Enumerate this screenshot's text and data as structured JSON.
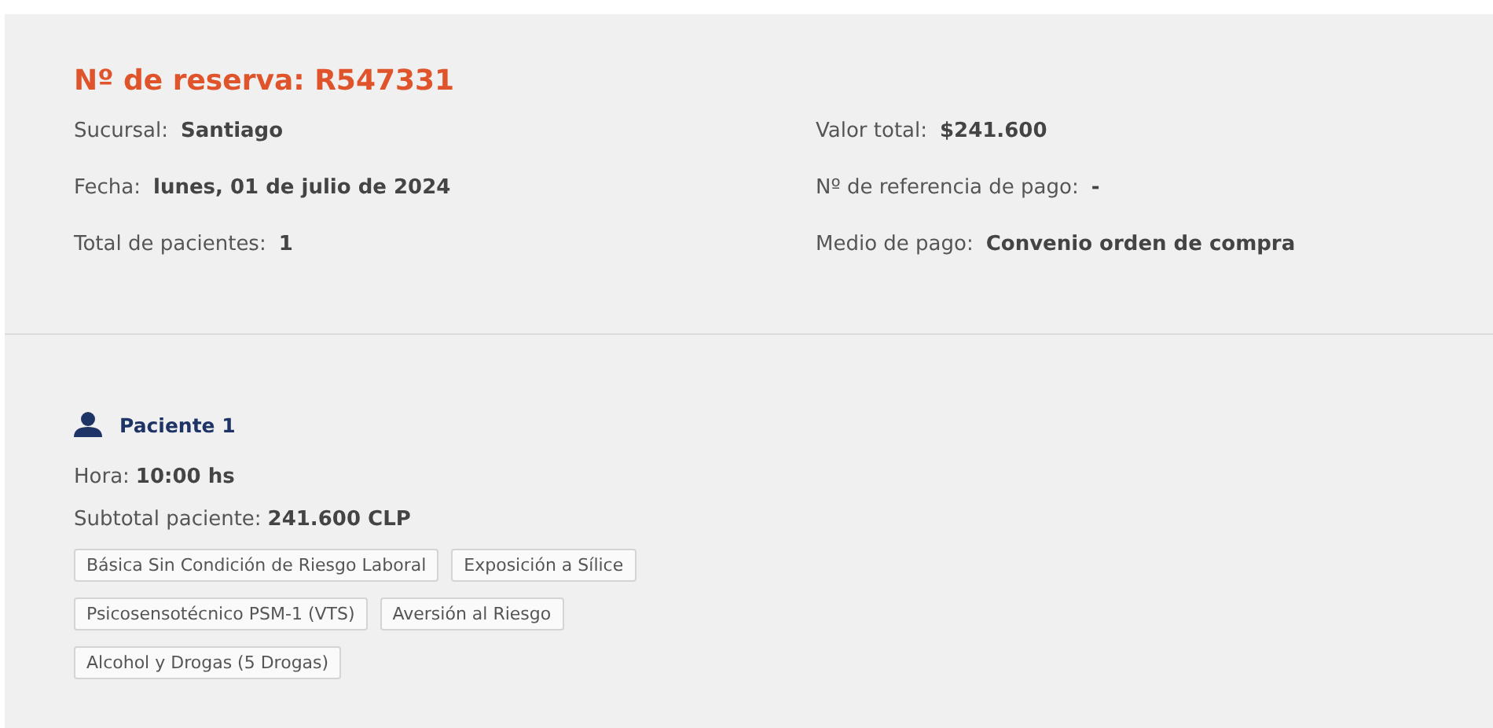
{
  "reservation": {
    "title": "Nº de reserva: R547331",
    "left": [
      {
        "label": "Sucursal:",
        "value": "Santiago"
      },
      {
        "label": "Fecha:",
        "value": "lunes, 01 de julio de 2024"
      },
      {
        "label": "Total de pacientes:",
        "value": "1"
      }
    ],
    "right": [
      {
        "label": "Valor total:",
        "value": "$241.600"
      },
      {
        "label": "Nº de referencia de pago:",
        "value": "-"
      },
      {
        "label": "Medio de pago:",
        "value": "Convenio orden de compra"
      }
    ]
  },
  "patients": [
    {
      "name": "Paciente 1",
      "details": [
        {
          "label": "Hora:",
          "value": "10:00 hs"
        },
        {
          "label": "Subtotal paciente:",
          "value": "241.600 CLP"
        }
      ],
      "exams": [
        "Básica Sin Condición de Riesgo Laboral",
        "Exposición a Sílice",
        "Psicosensotécnico PSM-1 (VTS)",
        "Aversión al Riesgo",
        "Alcohol y Drogas (5 Drogas)"
      ]
    }
  ]
}
